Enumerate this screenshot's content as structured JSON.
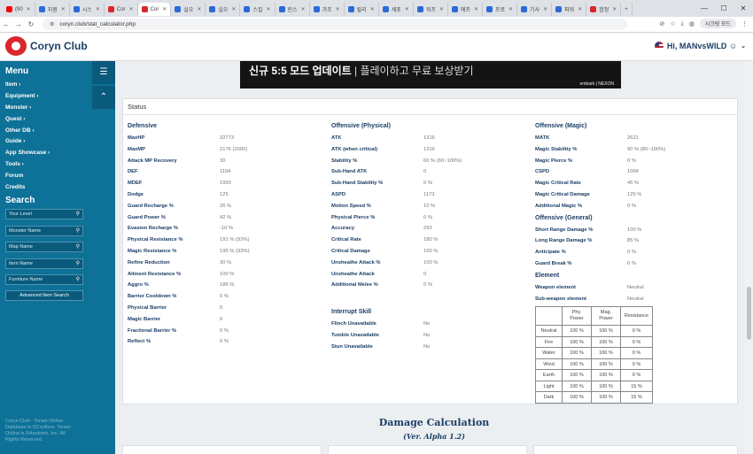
{
  "browser": {
    "tabs": [
      {
        "label": "(90",
        "color": "#ff0000"
      },
      {
        "label": "지원",
        "color": "#2c6bd6"
      },
      {
        "label": "시스",
        "color": "#2c6bd6"
      },
      {
        "label": "Cor",
        "color": "#d9262b"
      },
      {
        "label": "Cor",
        "color": "#d9262b",
        "active": true
      },
      {
        "label": "실오",
        "color": "#2c6bd6"
      },
      {
        "label": "실오",
        "color": "#2c6bd6"
      },
      {
        "label": "스킬",
        "color": "#2c6bd6"
      },
      {
        "label": "린스",
        "color": "#2c6bd6"
      },
      {
        "label": "가조",
        "color": "#2c6bd6"
      },
      {
        "label": "릴리",
        "color": "#2c6bd6"
      },
      {
        "label": "세포",
        "color": "#2c6bd6"
      },
      {
        "label": "워프",
        "color": "#2c6bd6"
      },
      {
        "label": "애프",
        "color": "#2c6bd6"
      },
      {
        "label": "프로",
        "color": "#2c6bd6"
      },
      {
        "label": "기사",
        "color": "#2c6bd6"
      },
      {
        "label": "파워",
        "color": "#2c6bd6"
      },
      {
        "label": "합정",
        "color": "#d9262b"
      }
    ],
    "url": "coryn.club/stat_calculator.php",
    "incognito_label": "시크릿 모드",
    "icons": {
      "back": "arrow-left-icon",
      "forward": "arrow-right-icon",
      "reload": "reload-icon",
      "lock": "site-info-icon"
    }
  },
  "site": {
    "logo_text": "Coryn Club",
    "user_greeting": "Hi, MANvsWILD ☺"
  },
  "sidebar": {
    "menu_title": "Menu",
    "items": [
      "Item ›",
      "Equipment ›",
      "Monster ›",
      "Quest ›",
      "Other DB ›",
      "Guide ›",
      "App Showcase ›",
      "Tools ›",
      "Forum",
      "Credits"
    ],
    "search_title": "Search",
    "fields": [
      "Your Level",
      "Monster Name",
      "Map Name",
      "Item Name",
      "Furniture Name"
    ],
    "advanced_label": "Advanced Item Search",
    "footer": "Coryn Club - Toram Online Database is ©Cruithne. Toram Online is ©Asobimo, Inc. All Rights Reserved."
  },
  "banner": {
    "headline": "신규 5:5 모드 업데이트",
    "tagline": " | 플레이하고 무료 보상받기",
    "footer_brand": "embark | NEXON"
  },
  "status": {
    "title": "Status",
    "defensive": {
      "heading": "Defensive",
      "rows": [
        {
          "label": "MaxHP",
          "value": "32773"
        },
        {
          "label": "MaxMP",
          "value": "2176 (2000)"
        },
        {
          "label": "Attack MP Recovery",
          "value": "30"
        },
        {
          "label": "DEF",
          "value": "1194"
        },
        {
          "label": "MDEF",
          "value": "1993"
        },
        {
          "label": "Dodge",
          "value": "125"
        },
        {
          "label": "Guard Recharge %",
          "value": "26 %"
        },
        {
          "label": "Guard Power %",
          "value": "42 %"
        },
        {
          "label": "Evasion Recharge %",
          "value": "-10 %"
        },
        {
          "label": "Physical Resistance %",
          "value": "191 % (92%)"
        },
        {
          "label": "Magic Resistance %",
          "value": "195 % (93%)"
        },
        {
          "label": "Refine Reduction",
          "value": "30 %"
        },
        {
          "label": "Ailment Resistance %",
          "value": "100 %"
        },
        {
          "label": "Aggro %",
          "value": "186 %"
        },
        {
          "label": "Barrier Cooldown %",
          "value": "0 %"
        },
        {
          "label": "Physical Barrier",
          "value": "0"
        },
        {
          "label": "Magic Barrier",
          "value": "0"
        },
        {
          "label": "Fractional Barrier %",
          "value": "0 %"
        },
        {
          "label": "Reflect %",
          "value": "0 %"
        }
      ]
    },
    "offensive_physical": {
      "heading": "Offensive (Physical)",
      "rows": [
        {
          "label": "ATK",
          "value": "1316"
        },
        {
          "label": "ATK (when critical)",
          "value": "1316"
        },
        {
          "label": "Stability %",
          "value": "60 % (60~100%)"
        },
        {
          "label": "Sub-Hand ATK",
          "value": "0"
        },
        {
          "label": "Sub-Hand Stability %",
          "value": "0 %"
        },
        {
          "label": "ASPD",
          "value": "1173"
        },
        {
          "label": "Motion Speed %",
          "value": "10 %"
        },
        {
          "label": "Physical Pierce %",
          "value": "0 %"
        },
        {
          "label": "Accuracy",
          "value": "293"
        },
        {
          "label": "Critical Rate",
          "value": "180 %"
        },
        {
          "label": "Critical Damage",
          "value": "150 %"
        },
        {
          "label": "Unsheathe Attack %",
          "value": "100 %"
        },
        {
          "label": "Unsheathe Attack",
          "value": "0"
        },
        {
          "label": "Additional Melee %",
          "value": "0 %"
        }
      ]
    },
    "interrupt": {
      "heading": "Interrupt Skill",
      "rows": [
        {
          "label": "Flinch Unavailable",
          "value": "No"
        },
        {
          "label": "Tumble Unavailable",
          "value": "No"
        },
        {
          "label": "Stun Unavailable",
          "value": "No"
        }
      ]
    },
    "offensive_magic": {
      "heading": "Offensive (Magic)",
      "rows": [
        {
          "label": "MATK",
          "value": "2621"
        },
        {
          "label": "Magic Stability %",
          "value": "90 % (80~100%)"
        },
        {
          "label": "Magic Pierce %",
          "value": "0 %"
        },
        {
          "label": "CSPD",
          "value": "1004"
        },
        {
          "label": "Magic Critical Rate",
          "value": "45 %"
        },
        {
          "label": "Magic Critical Damage",
          "value": "125 %"
        },
        {
          "label": "Additional Magic %",
          "value": "0 %"
        }
      ]
    },
    "offensive_general": {
      "heading": "Offensive (General)",
      "rows": [
        {
          "label": "Short Range Damage %",
          "value": "100 %"
        },
        {
          "label": "Long Range Damage %",
          "value": "85 %"
        },
        {
          "label": "Anticipate %",
          "value": "0 %"
        },
        {
          "label": "Guard Break %",
          "value": "0 %"
        }
      ]
    },
    "element": {
      "heading": "Element",
      "rows": [
        {
          "label": "Weapon element",
          "value": "Neutral"
        },
        {
          "label": "Sub-weapon element",
          "value": "Neutral"
        }
      ],
      "table_headers": [
        "",
        "Phy. Power",
        "Mag. Power",
        "Resistance"
      ],
      "table_rows": [
        [
          "Neutral",
          "100 %",
          "100 %",
          "0 %"
        ],
        [
          "Fire",
          "100 %",
          "100 %",
          "0 %"
        ],
        [
          "Water",
          "100 %",
          "100 %",
          "0 %"
        ],
        [
          "Wind",
          "100 %",
          "100 %",
          "0 %"
        ],
        [
          "Earth",
          "100 %",
          "100 %",
          "0 %"
        ],
        [
          "Light",
          "100 %",
          "100 %",
          "15 %"
        ],
        [
          "Dark",
          "100 %",
          "100 %",
          "15 %"
        ]
      ]
    }
  },
  "damage": {
    "title": "Damage Calculation",
    "subtitle": "(Ver. Alpha 1.2)"
  }
}
